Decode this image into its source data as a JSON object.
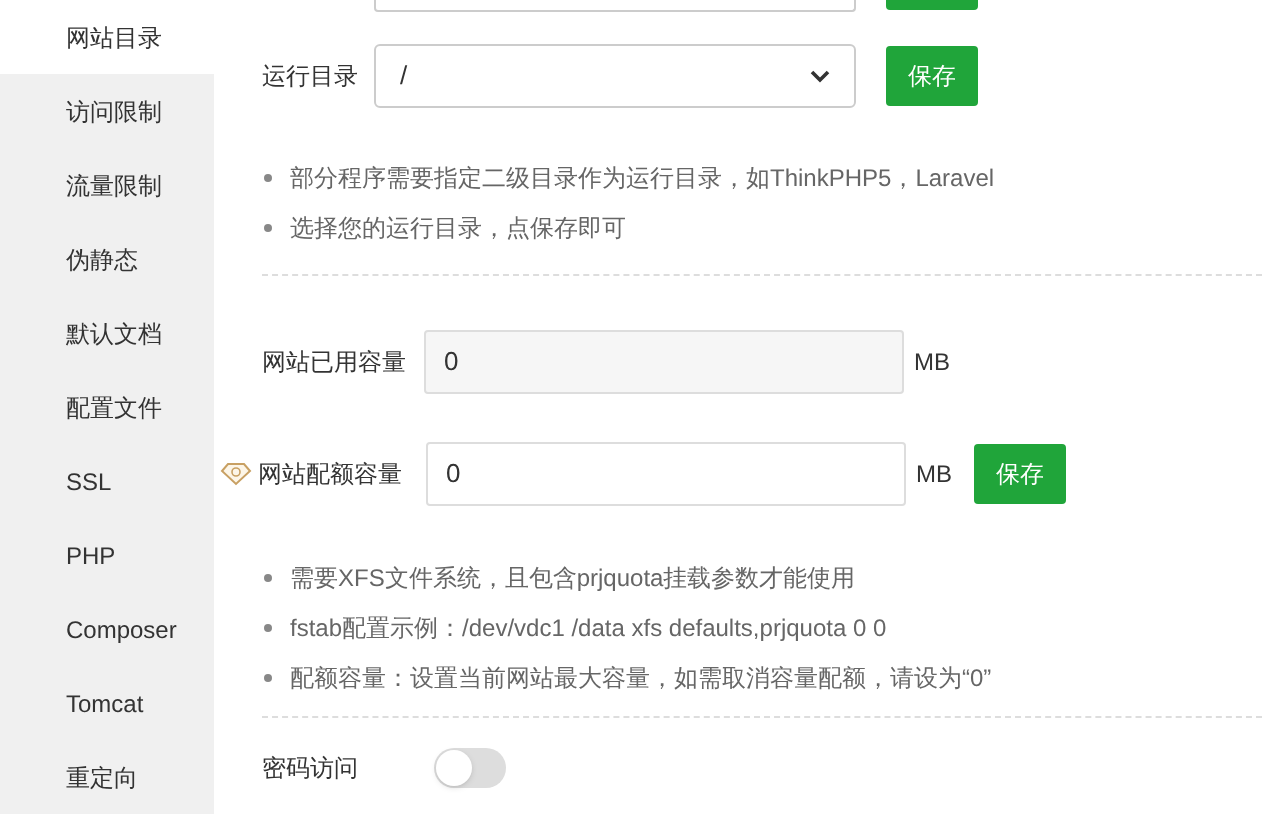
{
  "sidebar": {
    "items": [
      {
        "label": "网站目录",
        "selected": true
      },
      {
        "label": "访问限制",
        "selected": false
      },
      {
        "label": "流量限制",
        "selected": false
      },
      {
        "label": "伪静态",
        "selected": false
      },
      {
        "label": "默认文档",
        "selected": false
      },
      {
        "label": "配置文件",
        "selected": false
      },
      {
        "label": "SSL",
        "selected": false
      },
      {
        "label": "PHP",
        "selected": false
      },
      {
        "label": "Composer",
        "selected": false
      },
      {
        "label": "Tomcat",
        "selected": false
      },
      {
        "label": "重定向",
        "selected": false
      }
    ]
  },
  "run_directory": {
    "label": "运行目录",
    "value": "/",
    "button": "保存"
  },
  "run_tips": [
    "部分程序需要指定二级目录作为运行目录，如ThinkPHP5，Laravel",
    "选择您的运行目录，点保存即可"
  ],
  "used_capacity": {
    "label": "网站已用容量",
    "value": "0",
    "unit": "MB"
  },
  "quota_capacity": {
    "label": "网站配额容量",
    "value": "0",
    "unit": "MB",
    "button": "保存"
  },
  "quota_tips": [
    "需要XFS文件系统，且包含prjquota挂载参数才能使用",
    "fstab配置示例：/dev/vdc1 /data xfs defaults,prjquota 0 0",
    "配额容量：设置当前网站最大容量，如需取消容量配额，请设为“0”"
  ],
  "password_access": {
    "label": "密码访问",
    "on": false
  }
}
